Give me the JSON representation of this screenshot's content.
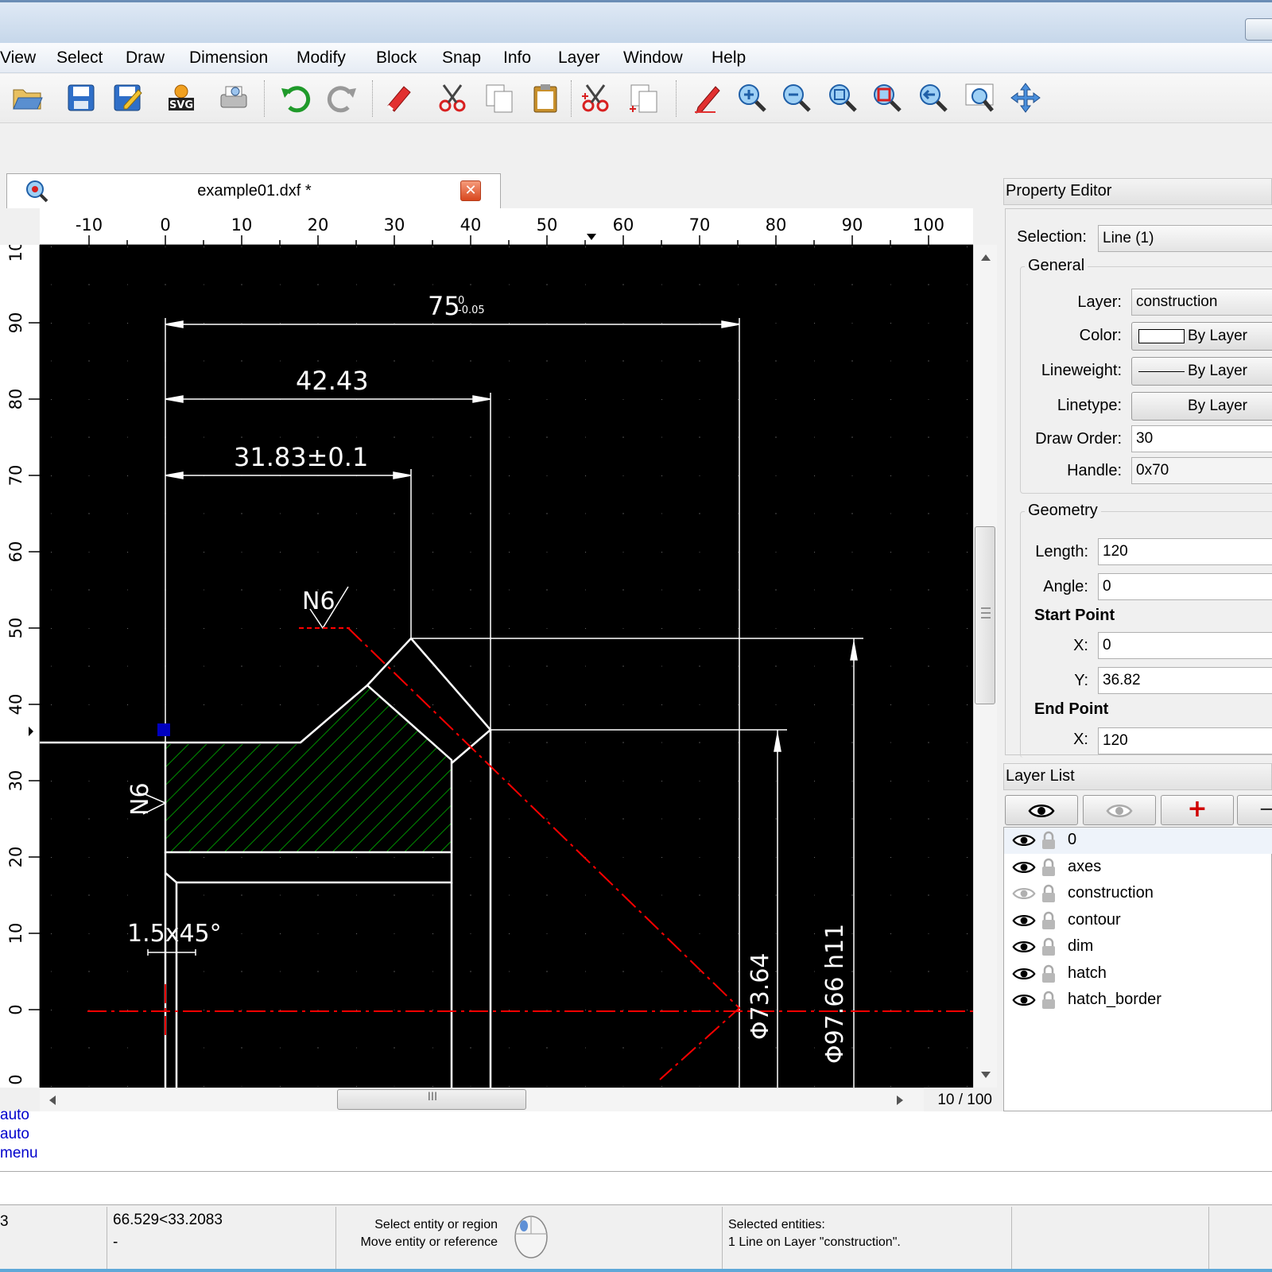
{
  "menu": [
    "View",
    "Select",
    "Draw",
    "Dimension",
    "Modify",
    "Block",
    "Snap",
    "Info",
    "Layer",
    "Window",
    "Help"
  ],
  "toolbar": {
    "icons": [
      "open-icon",
      "save-icon",
      "save-as-icon",
      "svg-export-icon",
      "print-preview-icon",
      "undo-icon",
      "redo-icon",
      "eraser-icon",
      "cut-icon",
      "copy-icon",
      "paste-icon",
      "cut-reference-icon",
      "copy-reference-icon",
      "pencil-icon",
      "zoom-in-icon",
      "zoom-out-icon",
      "zoom-auto-icon",
      "zoom-selection-icon",
      "zoom-previous-icon",
      "zoom-window-icon",
      "pan-icon"
    ],
    "svg_label": "SVG"
  },
  "document": {
    "tab_title": "example01.dxf *",
    "close_glyph": "✕"
  },
  "rulers": {
    "horizontal": [
      "-10",
      "0",
      "10",
      "20",
      "30",
      "40",
      "50",
      "60",
      "70",
      "80",
      "90",
      "100"
    ],
    "vertical": [
      "10",
      "90",
      "80",
      "70",
      "60",
      "50",
      "40",
      "30",
      "20",
      "10",
      "0",
      "0"
    ]
  },
  "drawing": {
    "dim_75": "75",
    "dim_75_tol": "0     \n-0.05",
    "dim_75_tol_upper": "0",
    "dim_75_tol_lower": "-0.05",
    "dim_4243": "42.43",
    "dim_3183": "31.83±0.1",
    "surface_top": "N6",
    "surface_left": "N6",
    "chamfer": "1.5x45°",
    "dia_7364": "Φ73.64",
    "dia_9766": "Φ97.66 h11"
  },
  "scroll": {
    "page_info": "10 / 100",
    "thumb_glyph": "III"
  },
  "command_history": [
    "auto",
    "auto",
    "menu"
  ],
  "status": {
    "left_value": "3",
    "coords": "66.529<33.2083",
    "coords_sub": "-",
    "hint_line1": "Select entity or region",
    "hint_line2": "Move entity or reference",
    "selected_title": "Selected entities:",
    "selected_detail": "1 Line on Layer \"construction\"."
  },
  "property_editor": {
    "title": "Property Editor",
    "selection_label": "Selection:",
    "selection_value": "Line (1)",
    "general_title": "General",
    "layer_label": "Layer:",
    "layer_value": "construction",
    "color_label": "Color:",
    "color_value": "By Layer",
    "lineweight_label": "Lineweight:",
    "lineweight_value": "By Layer",
    "linetype_label": "Linetype:",
    "linetype_value": "By Layer",
    "draw_order_label": "Draw Order:",
    "draw_order_value": "30",
    "handle_label": "Handle:",
    "handle_value": "0x70",
    "geometry_title": "Geometry",
    "length_label": "Length:",
    "length_value": "120",
    "angle_label": "Angle:",
    "angle_value": "0",
    "start_point_title": "Start Point",
    "start_x_label": "X:",
    "start_x_value": "0",
    "start_y_label": "Y:",
    "start_y_value": "36.82",
    "end_point_title": "End Point",
    "end_x_label": "X:",
    "end_x_value": "120"
  },
  "layer_list": {
    "title": "Layer List",
    "add_glyph": "+",
    "remove_glyph": "−",
    "layers": [
      {
        "name": "0",
        "visible": true
      },
      {
        "name": "axes",
        "visible": true
      },
      {
        "name": "construction",
        "visible": false
      },
      {
        "name": "contour",
        "visible": true
      },
      {
        "name": "dim",
        "visible": true
      },
      {
        "name": "hatch",
        "visible": true
      },
      {
        "name": "hatch_border",
        "visible": true
      }
    ]
  },
  "colors": {
    "canvas": "#000000",
    "hatch": "#00c000",
    "centerline": "#ff0000",
    "selection_grip": "#0000c0",
    "command_text": "#0000cc"
  }
}
